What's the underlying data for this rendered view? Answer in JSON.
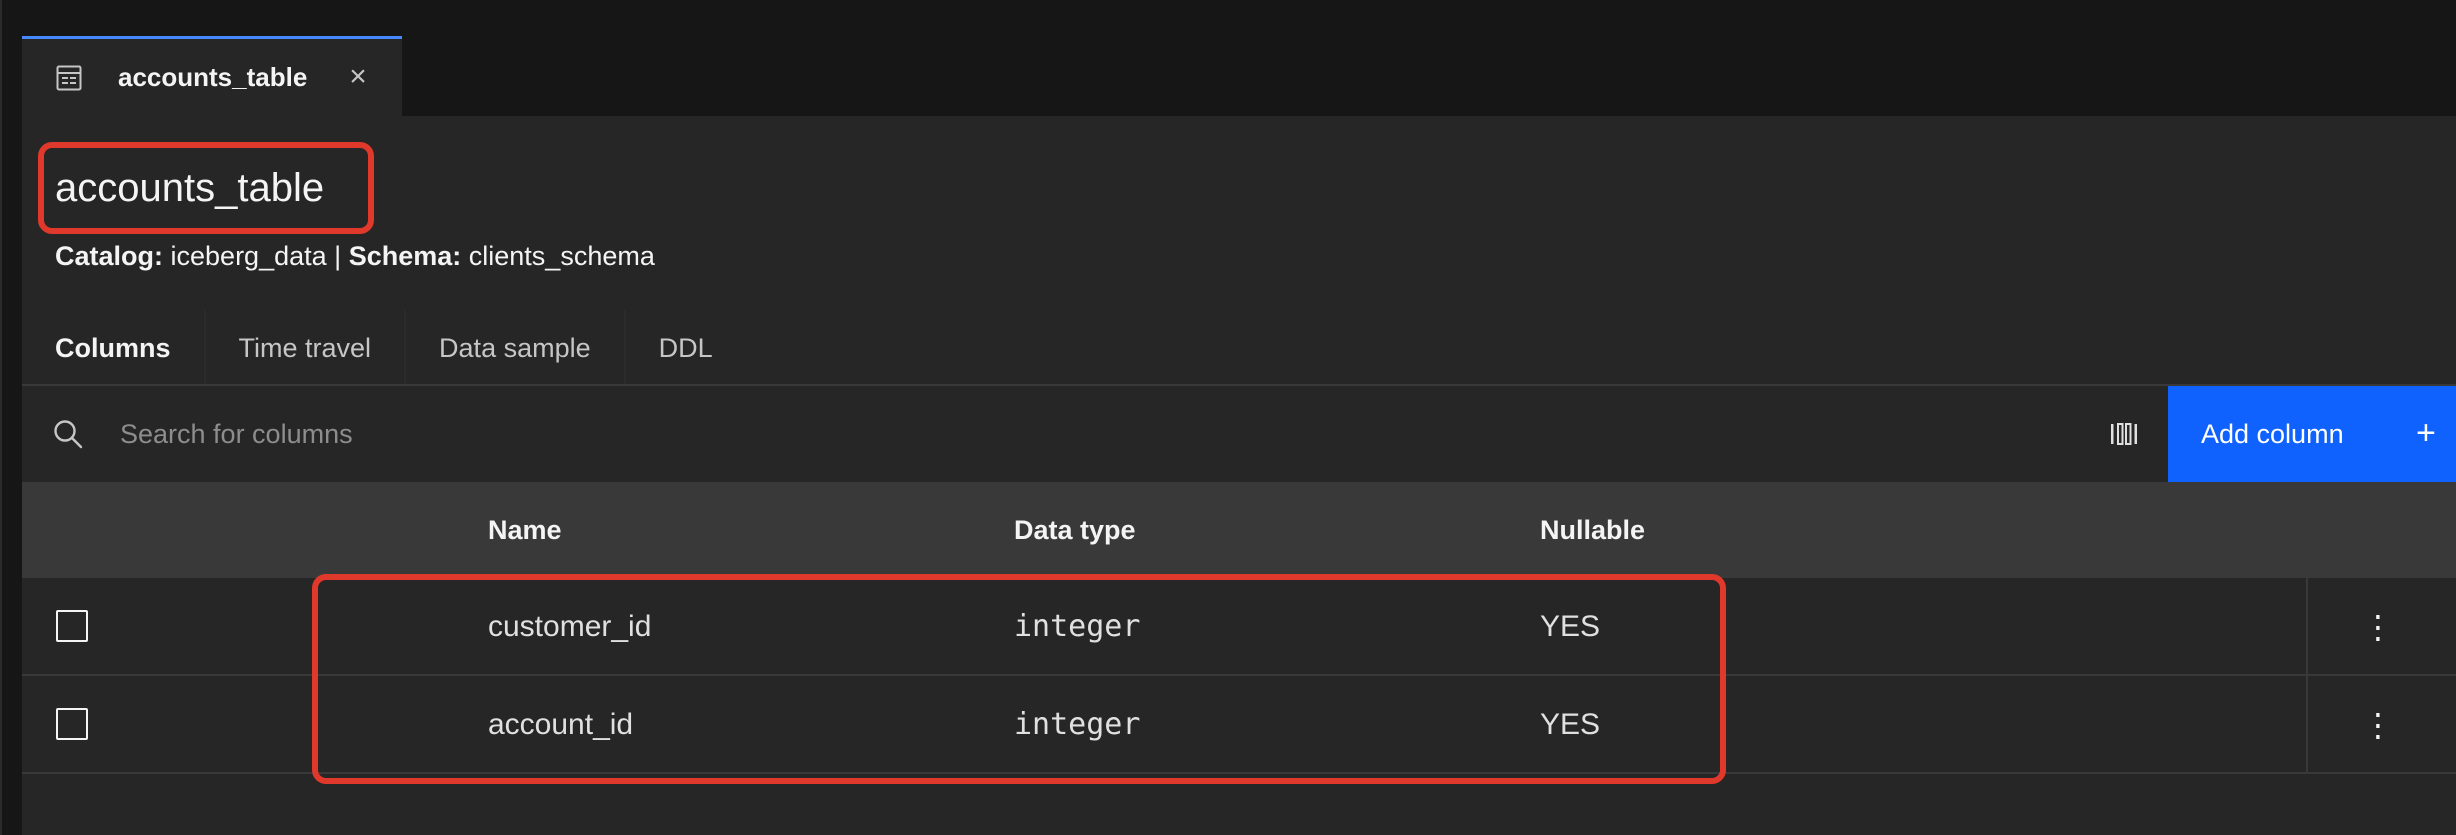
{
  "tab": {
    "title": "accounts_table",
    "close": "×"
  },
  "header": {
    "title": "accounts_table",
    "catalog_label": "Catalog:",
    "catalog_value": "iceberg_data",
    "separator": "|",
    "schema_label": "Schema:",
    "schema_value": "clients_schema"
  },
  "subtabs": [
    {
      "label": "Columns",
      "active": true
    },
    {
      "label": "Time travel",
      "active": false
    },
    {
      "label": "Data sample",
      "active": false
    },
    {
      "label": "DDL",
      "active": false
    }
  ],
  "toolbar": {
    "search_placeholder": "Search for columns",
    "add_label": "Add column",
    "add_icon": "+"
  },
  "table": {
    "headers": [
      "Name",
      "Data type",
      "Nullable"
    ],
    "rows": [
      {
        "name": "customer_id",
        "data_type": "integer",
        "nullable": "YES"
      },
      {
        "name": "account_id",
        "data_type": "integer",
        "nullable": "YES"
      }
    ]
  },
  "colors": {
    "accent": "#4589ff",
    "primary_button": "#0f62fe",
    "highlight": "#e0392b",
    "background": "#262626"
  },
  "icons": {
    "tab": "table-icon",
    "search": "search-icon",
    "settings": "column-settings-icon",
    "overflow": "overflow-menu-icon"
  }
}
